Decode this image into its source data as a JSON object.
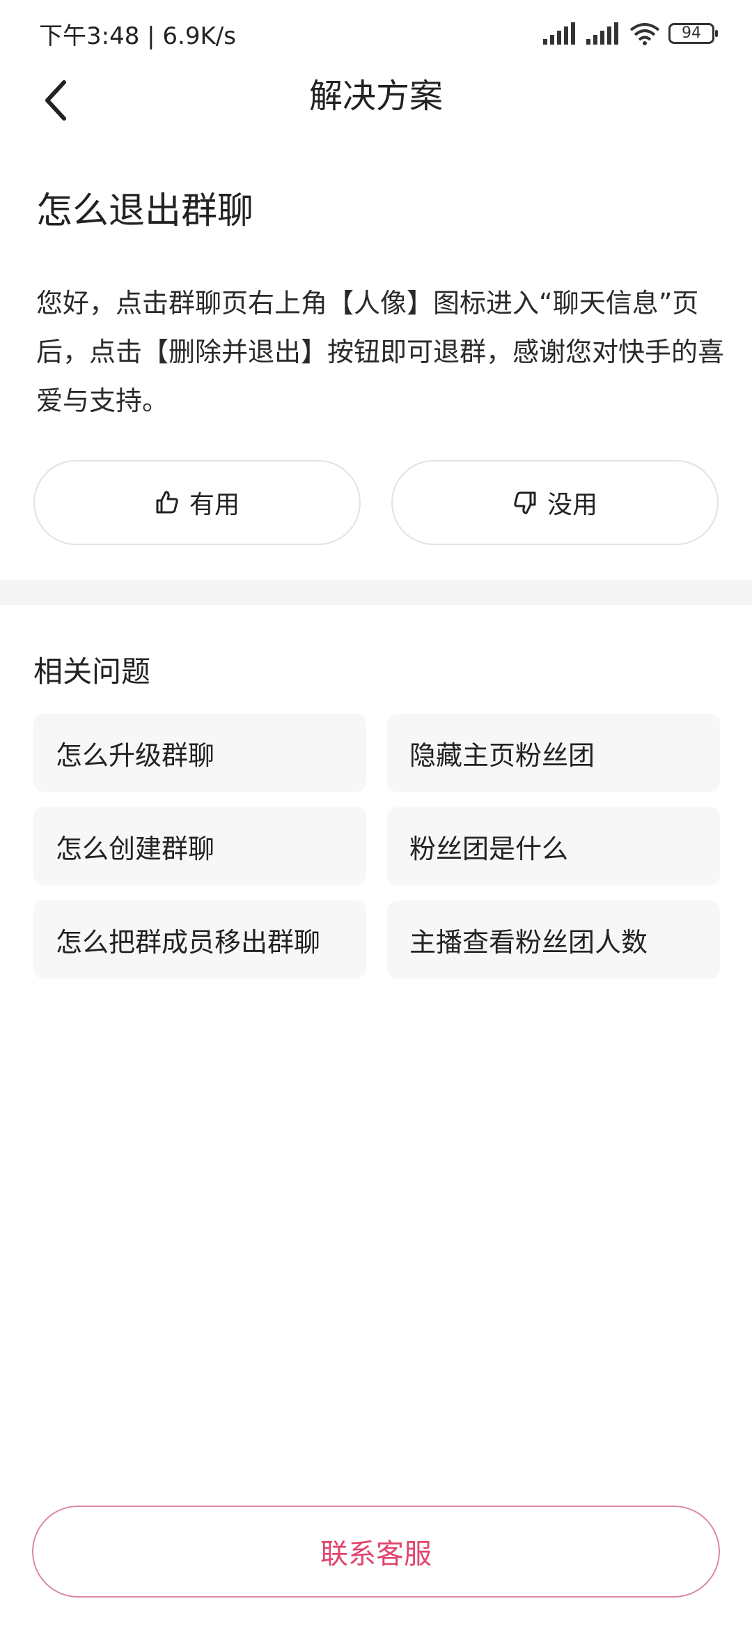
{
  "status_bar": {
    "time": "下午3:48 | 6.9K/s",
    "battery": "94"
  },
  "nav": {
    "title": "解决方案"
  },
  "question": {
    "title": "怎么退出群聊",
    "answer": "您好，点击群聊页右上角【人像】图标进入“聊天信息”页后，点击【删除并退出】按钮即可退群，感谢您对快手的喜爱与支持。"
  },
  "feedback": {
    "useful_label": "有用",
    "useless_label": "没用"
  },
  "related": {
    "title": "相关问题",
    "items": [
      "怎么升级群聊",
      "隐藏主页粉丝团",
      "怎么创建群聊",
      "粉丝团是什么",
      "怎么把群成员移出群聊",
      "主播查看粉丝团人数"
    ]
  },
  "contact": {
    "label": "联系客服",
    "accent_color": "#e0456e"
  }
}
